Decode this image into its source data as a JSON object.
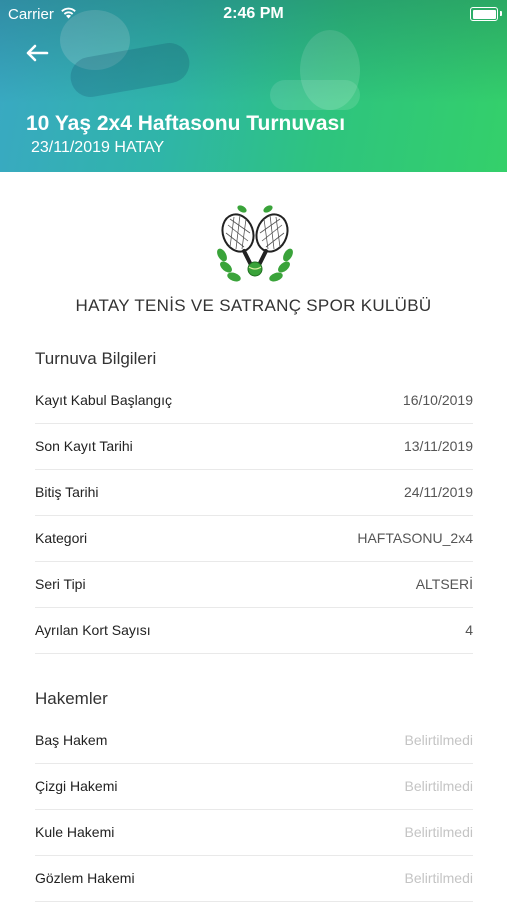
{
  "status_bar": {
    "carrier": "Carrier",
    "time": "2:46 PM"
  },
  "header": {
    "title": "10 Yaş 2x4 Haftasonu Turnuvası",
    "subtitle": "23/11/2019 HATAY"
  },
  "club": {
    "name": "HATAY TENİS VE SATRANÇ SPOR KULÜBÜ"
  },
  "tournament_info": {
    "title": "Turnuva Bilgileri",
    "rows": [
      {
        "label": "Kayıt Kabul Başlangıç",
        "value": "16/10/2019"
      },
      {
        "label": "Son Kayıt Tarihi",
        "value": "13/11/2019"
      },
      {
        "label": "Bitiş Tarihi",
        "value": "24/11/2019"
      },
      {
        "label": "Kategori",
        "value": "HAFTASONU_2x4"
      },
      {
        "label": "Seri Tipi",
        "value": "ALTSERİ"
      },
      {
        "label": "Ayrılan Kort Sayısı",
        "value": "4"
      }
    ]
  },
  "referees": {
    "title": "Hakemler",
    "rows": [
      {
        "label": "Baş Hakem",
        "value": "Belirtilmedi"
      },
      {
        "label": "Çizgi Hakemi",
        "value": "Belirtilmedi"
      },
      {
        "label": "Kule Hakemi",
        "value": "Belirtilmedi"
      },
      {
        "label": "Gözlem Hakemi",
        "value": "Belirtilmedi"
      }
    ]
  },
  "colors": {
    "header_start": "#3aa8c4",
    "header_end": "#34d06a",
    "muted_value": "#c4c4c4",
    "logo_green": "#3aa33a"
  },
  "icons": [
    "wifi-icon",
    "battery-icon",
    "back-arrow-icon",
    "club-logo"
  ]
}
